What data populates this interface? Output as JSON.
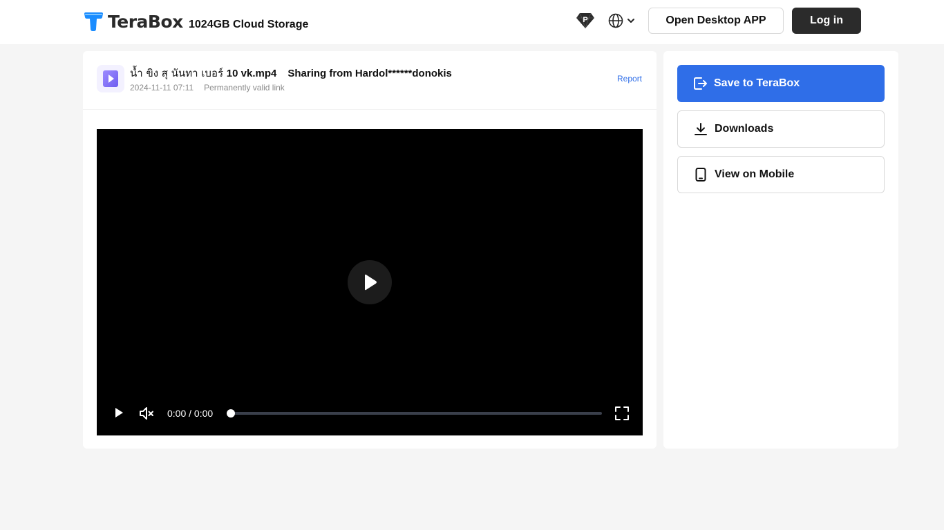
{
  "header": {
    "brand": "TeraBox",
    "tagline": "1024GB Cloud Storage",
    "open_desktop_label": "Open Desktop APP",
    "login_label": "Log in",
    "premium_icon": "diamond-p-icon",
    "language_icon": "globe-icon"
  },
  "file": {
    "name_thai": "น้ำ ขิง สุ นันทา เบอร์ ",
    "name_rest": "10 vk.mp4",
    "sharing": "Sharing from Hardol******donokis",
    "date": "2024-11-11 07:11",
    "validity": "Permanently valid link",
    "report_label": "Report",
    "type_icon": "video-file-icon"
  },
  "player": {
    "time": "0:00 / 0:00",
    "progress": 0,
    "muted": true
  },
  "side": {
    "save_label": "Save to TeraBox",
    "download_label": "Downloads",
    "mobile_label": "View on Mobile"
  },
  "colors": {
    "accent": "#2f6ee8",
    "dark_button": "#2b2b2b",
    "page_bg": "#f5f5f5"
  }
}
